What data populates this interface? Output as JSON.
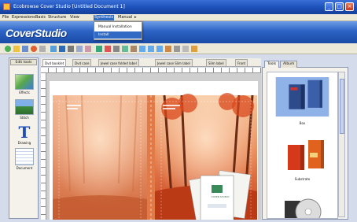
{
  "window": {
    "title": "Ecobrowse Cover Studio [Untitled Document 1]"
  },
  "menu": {
    "items": [
      {
        "label": "File",
        "active": false
      },
      {
        "label": "Expressions",
        "active": false
      },
      {
        "label": "Basic",
        "active": false
      },
      {
        "label": "Structure",
        "active": false
      },
      {
        "label": "View",
        "active": false
      },
      {
        "label": "Synthesis",
        "active": true
      },
      {
        "label": "Manual",
        "active": false
      }
    ],
    "dropdown": [
      "Manual Installation",
      "Install"
    ]
  },
  "app": {
    "logo": "CoverStudio"
  },
  "toolbox": {
    "tab": "Edit tools",
    "tools": [
      {
        "label": "Effects",
        "icon": "effects-icon"
      },
      {
        "label": "Stitch",
        "icon": "stitch-icon"
      },
      {
        "label": "Drawing",
        "icon": "text-icon"
      },
      {
        "label": "Document",
        "icon": "document-icon"
      }
    ]
  },
  "doc_tabs": [
    {
      "label": "Dvd booklet",
      "active": true
    },
    {
      "label": "Dvd case",
      "active": false
    },
    {
      "label": "Jewel case folded label",
      "active": false
    },
    {
      "label": "Jewel case Slim label",
      "active": false
    },
    {
      "label": "Slim label",
      "active": false
    },
    {
      "label": "Front",
      "active": false
    }
  ],
  "right_panel": {
    "tabs": [
      {
        "label": "Tools",
        "active": true
      },
      {
        "label": "Album",
        "active": false
      }
    ],
    "thumbs": [
      {
        "label": "Box"
      },
      {
        "label": "Substrate"
      },
      {
        "label": ""
      }
    ]
  },
  "card": {
    "caption": "COVER STUDIO"
  },
  "colors": {
    "titlebar": "#1c4fb8",
    "banner": "#2c63c4",
    "autumn_orange": "#d4582a",
    "selected_thumb": "#8fb2e8"
  }
}
